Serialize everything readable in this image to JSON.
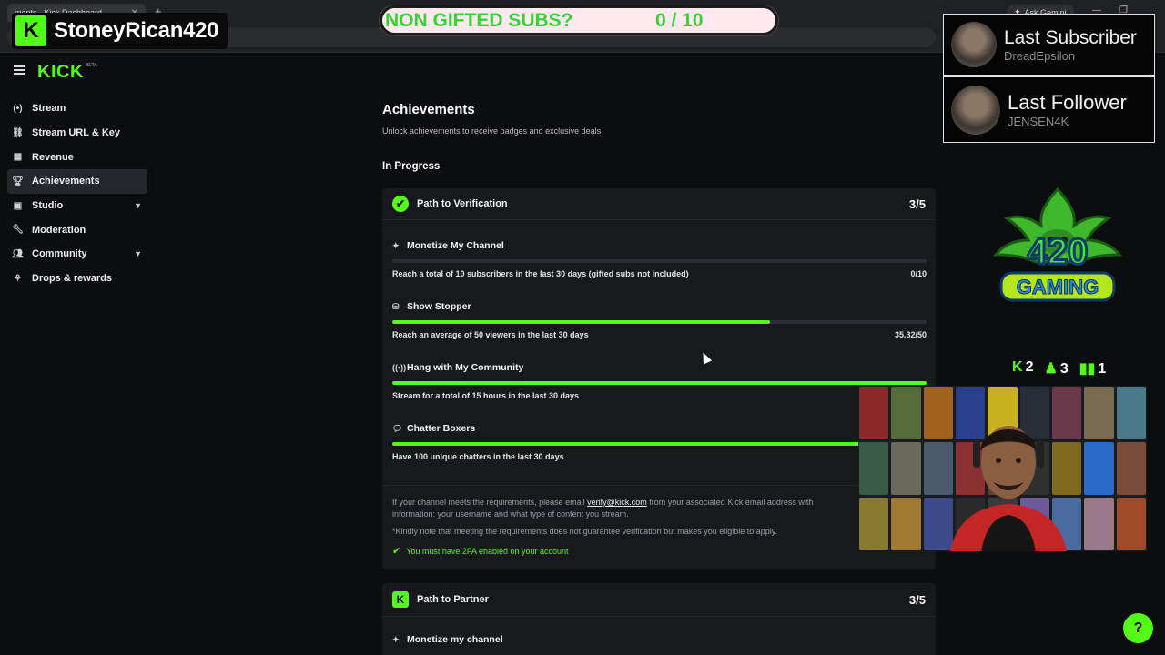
{
  "browser": {
    "tab_title": "ments - Kick Dashboard",
    "ask_gemini": "Ask Gemini"
  },
  "overlay": {
    "channel_name": "StoneyRican420",
    "subs_goal_label": "NON GIFTED SUBS?",
    "subs_goal_count": "0 / 10",
    "last_subscriber_label": "Last Subscriber",
    "last_subscriber_name": "DreadEpsilon",
    "last_follower_label": "Last Follower",
    "last_follower_name": "JENSEN4K",
    "logo_text_top": "420",
    "logo_text_bottom": "GAMING",
    "stats": [
      {
        "icon": "kick-icon",
        "value": "2"
      },
      {
        "icon": "person-icon",
        "value": "3"
      },
      {
        "icon": "bar-chart-icon",
        "value": "1"
      }
    ]
  },
  "kick": {
    "logo": "KICK",
    "beta": "BETA"
  },
  "sidebar": {
    "items": [
      {
        "label": "Stream",
        "icon": "stream-icon",
        "active": false,
        "expandable": false
      },
      {
        "label": "Stream URL & Key",
        "icon": "link-icon",
        "active": false,
        "expandable": false
      },
      {
        "label": "Revenue",
        "icon": "revenue-icon",
        "active": false,
        "expandable": false
      },
      {
        "label": "Achievements",
        "icon": "trophy-icon",
        "active": true,
        "expandable": false
      },
      {
        "label": "Studio",
        "icon": "studio-icon",
        "active": false,
        "expandable": true
      },
      {
        "label": "Moderation",
        "icon": "wrench-icon",
        "active": false,
        "expandable": false
      },
      {
        "label": "Community",
        "icon": "community-icon",
        "active": false,
        "expandable": true
      },
      {
        "label": "Drops & rewards",
        "icon": "drops-icon",
        "active": false,
        "expandable": false
      }
    ]
  },
  "main": {
    "title": "Achievements",
    "subtitle": "Unlock achievements to receive badges and exclusive deals",
    "in_progress": "In Progress",
    "verification": {
      "title": "Path to Verification",
      "score": "3/5",
      "achievements": [
        {
          "title": "Monetize My Channel",
          "desc": "Reach a total of 10 subscribers in the last 30 days (gifted subs not included)",
          "value": "0/10",
          "progress": 0
        },
        {
          "title": "Show Stopper",
          "desc": "Reach an average of 50 viewers in the last 30 days",
          "value": "35.32/50",
          "progress": 0.7064
        },
        {
          "title": "Hang with My Community",
          "desc": "Stream for a total of 15 hours in the last 30 days",
          "value": "",
          "progress": 1
        },
        {
          "title": "Chatter Boxers",
          "desc": "Have 100 unique chatters in the last 30 days",
          "value": "",
          "progress": 1
        }
      ],
      "info_pre": "If your channel meets the requirements, please email ",
      "info_email": "verify@kick.com",
      "info_post": " from your associated Kick email address with",
      "info_line2": "information: your username and what type of content you stream.",
      "note": "*Kindly note that meeting the requirements does not guarantee verification but makes you eligible to apply.",
      "requirement": "You must have 2FA enabled on your account"
    },
    "partner": {
      "title": "Path to Partner",
      "score": "3/5",
      "first_achievement": "Monetize my channel"
    }
  },
  "colors": {
    "accent": "#53fc18",
    "background": "#0b0d0f",
    "card": "#17191c"
  }
}
